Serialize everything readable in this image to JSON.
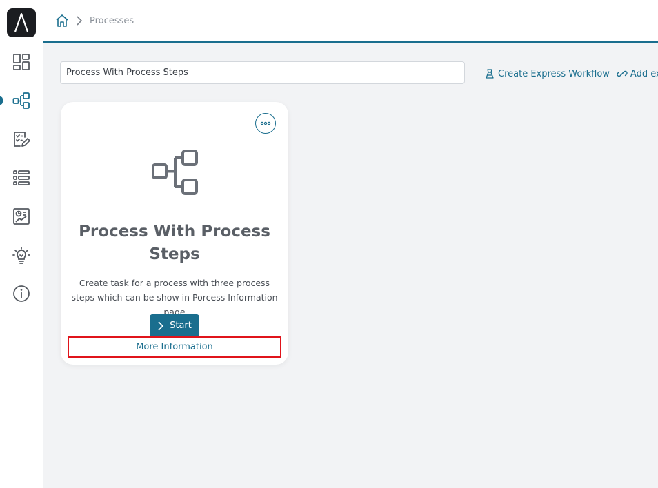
{
  "breadcrumb": {
    "current": "Processes"
  },
  "search": {
    "value": "Process With Process Steps"
  },
  "actions": {
    "create_express_workflow": "Create Express Workflow",
    "add_external": "Add exte"
  },
  "card": {
    "title": "Process With Process Steps",
    "description": "Create task for a process with three process steps which can be show in Porcess Information page",
    "start_label": "Start",
    "more_info_label": "More Information"
  },
  "sidebar": {
    "items": [
      {
        "name": "dashboard-icon"
      },
      {
        "name": "processes-icon",
        "active": true
      },
      {
        "name": "tasks-icon"
      },
      {
        "name": "list-icon"
      },
      {
        "name": "reports-icon"
      },
      {
        "name": "ideas-icon"
      },
      {
        "name": "info-icon"
      }
    ]
  },
  "colors": {
    "accent": "#1a6e8e",
    "highlight": "#e0141b",
    "background": "#f2f3f5"
  }
}
